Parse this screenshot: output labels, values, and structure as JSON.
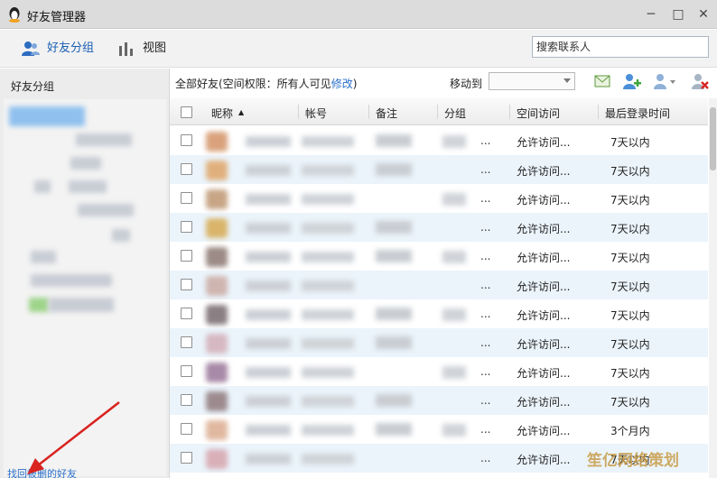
{
  "window": {
    "title": "好友管理器",
    "minimize": "─",
    "maximize": "□",
    "close": "✕"
  },
  "toolbar": {
    "groups_label": "好友分组",
    "view_label": "视图",
    "search_placeholder": "搜索联系人"
  },
  "sidebar": {
    "header": "好友分组",
    "restore_link": "找回被删的好友"
  },
  "main": {
    "crumb_prefix": "全部好友(空间权限：所有人可见",
    "crumb_link": "修改",
    "crumb_suffix": ")",
    "move_to_label": "移动到"
  },
  "table": {
    "columns": [
      "昵称",
      "帐号",
      "备注",
      "分组",
      "空间访问",
      "最后登录时间"
    ],
    "sort_indicator": "▲",
    "rows": [
      {
        "access": "允许访问...",
        "last_login": "7天以内"
      },
      {
        "access": "允许访问...",
        "last_login": "7天以内"
      },
      {
        "access": "允许访问...",
        "last_login": "7天以内"
      },
      {
        "access": "允许访问...",
        "last_login": "7天以内"
      },
      {
        "access": "允许访问...",
        "last_login": "7天以内"
      },
      {
        "access": "允许访问...",
        "last_login": "7天以内"
      },
      {
        "access": "允许访问...",
        "last_login": "7天以内"
      },
      {
        "access": "允许访问...",
        "last_login": "7天以内"
      },
      {
        "access": "允许访问...",
        "last_login": "7天以内"
      },
      {
        "access": "允许访问...",
        "last_login": "7天以内"
      },
      {
        "access": "允许访问...",
        "last_login": "3个月内"
      },
      {
        "access": "允许访问...",
        "last_login": "7天以内"
      }
    ]
  },
  "watermark": "笙亿网络策划",
  "colors": {
    "accent": "#1a5fb4",
    "link": "#2a6fc9",
    "row_alt": "#ebf4fb",
    "annotation_arrow": "#d8231f"
  }
}
